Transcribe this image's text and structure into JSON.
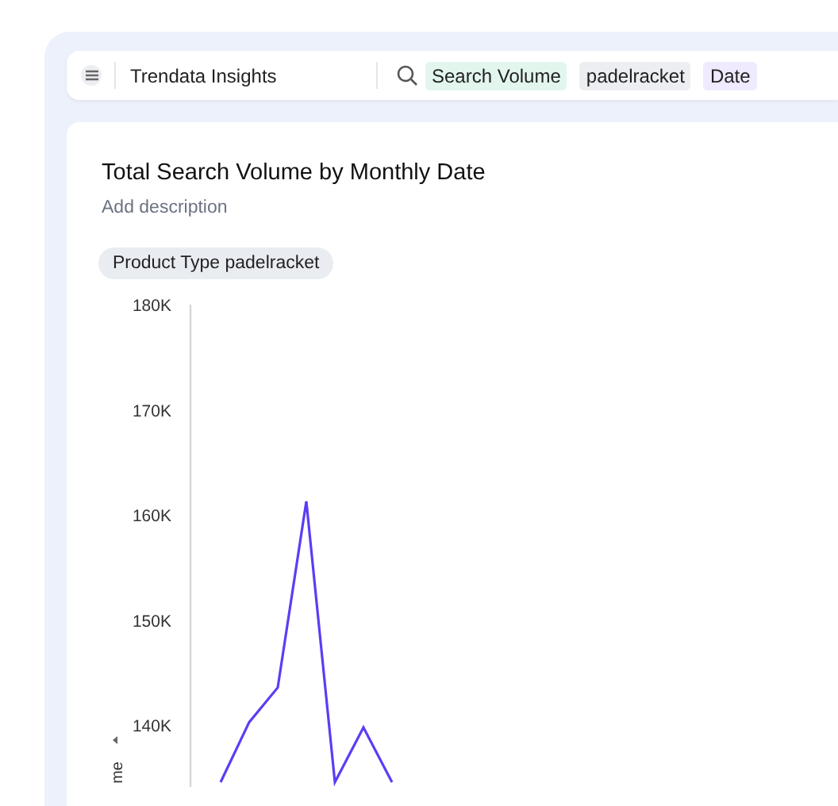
{
  "app_bar": {
    "title": "Trendata Insights",
    "search_chips": [
      {
        "label": "Search Volume",
        "color": "#e2f6ee"
      },
      {
        "label": "padelracket",
        "color": "#eceef2"
      },
      {
        "label": "Date",
        "color": "#efeafd"
      }
    ]
  },
  "card": {
    "title": "Total Search Volume by Monthly Date",
    "description_placeholder": "Add description",
    "filter_chips": [
      "Product Type padelracket"
    ],
    "chart_data": {
      "type": "line",
      "ylabel": "me",
      "ylim": [
        134300,
        180000
      ],
      "categories": [
        null,
        null,
        null,
        null,
        null,
        null,
        null
      ],
      "yticks": [
        {
          "value": 180000,
          "label": "180K"
        },
        {
          "value": 170000,
          "label": "170K"
        },
        {
          "value": 160000,
          "label": "160K"
        },
        {
          "value": 150000,
          "label": "150K"
        },
        {
          "value": 140000,
          "label": "140K"
        }
      ],
      "series": [
        {
          "color": "#5b3df5",
          "values": [
            134600,
            140300,
            143600,
            161300,
            134600,
            139800,
            134600
          ]
        }
      ]
    }
  }
}
